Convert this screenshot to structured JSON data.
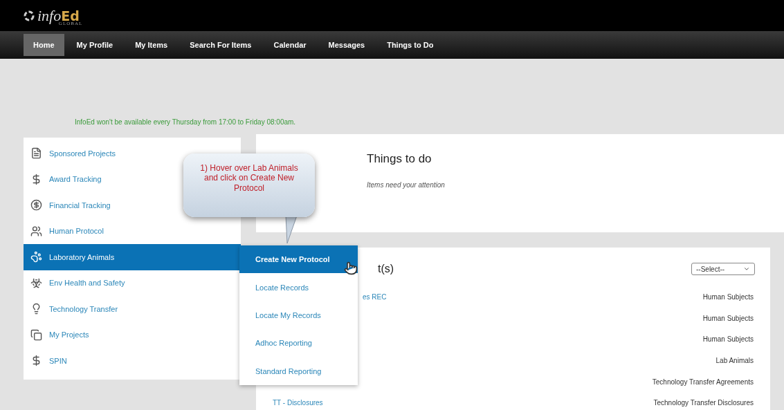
{
  "logo": {
    "text": "info",
    "accent": "Ed",
    "sub": "GLOBAL"
  },
  "nav": [
    {
      "label": "Home",
      "selected": true
    },
    {
      "label": "My Profile",
      "selected": false
    },
    {
      "label": "My Items",
      "selected": false
    },
    {
      "label": "Search For Items",
      "selected": false
    },
    {
      "label": "Calendar",
      "selected": false
    },
    {
      "label": "Messages",
      "selected": false
    },
    {
      "label": "Things to Do",
      "selected": false
    }
  ],
  "notice": "InfoEd won't be available every Thursday from 17:00 to Friday 08:00am.",
  "sidebar": {
    "items": [
      {
        "label": "Sponsored Projects",
        "selected": false
      },
      {
        "label": "Award Tracking",
        "selected": false
      },
      {
        "label": "Financial Tracking",
        "selected": false
      },
      {
        "label": "Human Protocol",
        "selected": false
      },
      {
        "label": "Laboratory Animals",
        "selected": true
      },
      {
        "label": "Env Health and Safety",
        "selected": false
      },
      {
        "label": "Technology Transfer",
        "selected": false
      },
      {
        "label": "My Projects",
        "selected": false
      },
      {
        "label": "SPIN",
        "selected": false
      }
    ]
  },
  "submenu": [
    {
      "label": "Create New Protocol",
      "selected": true
    },
    {
      "label": "Locate Records",
      "selected": false
    },
    {
      "label": "Locate My Records",
      "selected": false
    },
    {
      "label": "Adhoc Reporting",
      "selected": false
    },
    {
      "label": "Standard Reporting",
      "selected": false
    }
  ],
  "things_to_do": {
    "title": "Things to do",
    "subtitle": "Items need your attention"
  },
  "records_card": {
    "title": "t(s)",
    "select": "--Select--",
    "rows": [
      {
        "name": "es REC",
        "type": "Human Subjects"
      },
      {
        "type": "Human Subjects"
      },
      {
        "type": "Human Subjects"
      },
      {
        "type": "Lab Animals"
      },
      {
        "type": "Technology Transfer Agreements"
      },
      {
        "name": "TT - Disclosures",
        "type": "Technology Transfer Disclosures"
      }
    ]
  },
  "callout": "1) Hover over Lab Animals and click on Create New Protocol"
}
